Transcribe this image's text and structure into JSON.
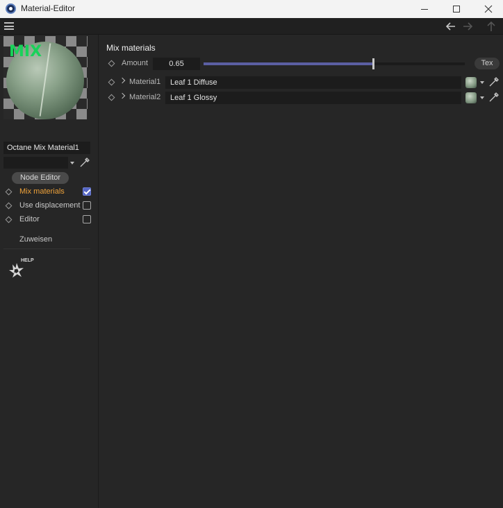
{
  "window": {
    "title": "Material-Editor",
    "app_icon": "cinema4d-icon",
    "controls": [
      "minimize-icon",
      "maximize-icon",
      "close-icon"
    ]
  },
  "toolbar": {
    "menu_icon": "hamburger-menu-icon",
    "nav_icons": [
      "arrow-left-icon",
      "arrow-right-icon",
      "arrow-up-icon"
    ]
  },
  "sidebar": {
    "preview_label": "MIX",
    "material_name": "Octane Mix Material1",
    "layer_value": "",
    "node_editor_label": "Node Editor",
    "channels": [
      {
        "label": "Mix materials",
        "checked": true,
        "active": true
      },
      {
        "label": "Use displacement",
        "checked": false,
        "active": false
      },
      {
        "label": "Editor",
        "checked": false,
        "active": false
      }
    ],
    "assign_label": "Zuweisen",
    "help_label": "HELP"
  },
  "main": {
    "section_title": "Mix materials",
    "amount": {
      "label": "Amount",
      "value": "0.65",
      "fraction": 0.65,
      "tex_label": "Tex"
    },
    "materials": [
      {
        "label": "Material1",
        "value": "Leaf 1 Diffuse"
      },
      {
        "label": "Material2",
        "value": "Leaf 1 Glossy"
      }
    ]
  },
  "colors": {
    "accent": "#5b5fa3",
    "active_label": "#f0a33a",
    "checkbox_on": "#5566c4",
    "mix_label": "#19d25a"
  }
}
